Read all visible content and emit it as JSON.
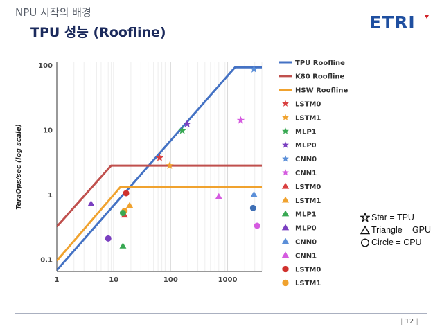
{
  "header": {
    "supertitle": "NPU 시작의 배경",
    "title": "TPU 성능 (Roofline)",
    "logo_text": "ETRI",
    "logo_color": "#1f4fa0",
    "logo_accent": "#d2232a"
  },
  "footer": {
    "page_number": "12"
  },
  "shape_key": [
    {
      "symbol": "star-outline",
      "label": "Star = TPU"
    },
    {
      "symbol": "triangle-outline",
      "label": "Triangle = GPU"
    },
    {
      "symbol": "circle-outline",
      "label": "Circle = CPU"
    }
  ],
  "chart_data": {
    "type": "scatter",
    "title": "",
    "xlabel": "",
    "ylabel": "TeraOps/sec (log scale)",
    "x_scale": "log",
    "y_scale": "log",
    "xlim": [
      1,
      4000
    ],
    "ylim": [
      0.065,
      110
    ],
    "x_ticks": [
      {
        "value": 1,
        "label": "1"
      },
      {
        "value": 10,
        "label": "10"
      },
      {
        "value": 100,
        "label": "100"
      },
      {
        "value": 1000,
        "label": "1000"
      }
    ],
    "y_ticks": [
      {
        "value": 0.1,
        "label": "0.1"
      },
      {
        "value": 1,
        "label": "1"
      },
      {
        "value": 10,
        "label": "10"
      },
      {
        "value": 100,
        "label": "100"
      }
    ],
    "grid": "vertical",
    "legend_position": "right",
    "rooflines": [
      {
        "name": "TPU Roofline",
        "color": "#4472c4",
        "points": [
          [
            1,
            0.068
          ],
          [
            1350,
            92
          ],
          [
            4000,
            92
          ]
        ]
      },
      {
        "name": "K80 Roofline",
        "color": "#c0504d",
        "points": [
          [
            1,
            0.32
          ],
          [
            9,
            2.8
          ],
          [
            4000,
            2.8
          ]
        ]
      },
      {
        "name": "HSW Roofline",
        "color": "#f0a22e",
        "points": [
          [
            1,
            0.095
          ],
          [
            13,
            1.3
          ],
          [
            4000,
            1.3
          ]
        ]
      }
    ],
    "series": [
      {
        "name": "LSTM0",
        "marker": "star",
        "color": "#d94040",
        "points": [
          [
            64,
            3.7
          ]
        ]
      },
      {
        "name": "LSTM1",
        "marker": "star",
        "color": "#f0a22e",
        "points": [
          [
            96,
            2.8
          ]
        ]
      },
      {
        "name": "MLP1",
        "marker": "star",
        "color": "#38a852",
        "points": [
          [
            160,
            9.7
          ]
        ]
      },
      {
        "name": "MLP0",
        "marker": "star",
        "color": "#7a3fc0",
        "points": [
          [
            195,
            12.3
          ]
        ]
      },
      {
        "name": "CNN0",
        "marker": "star",
        "color": "#5b8fd8",
        "points": [
          [
            2900,
            86
          ]
        ]
      },
      {
        "name": "CNN1",
        "marker": "star",
        "color": "#d55be0",
        "points": [
          [
            1700,
            14
          ]
        ]
      },
      {
        "name": "LSTM0",
        "marker": "triangle",
        "color": "#d94040",
        "points": [
          [
            15.5,
            0.48
          ]
        ]
      },
      {
        "name": "LSTM1",
        "marker": "triangle",
        "color": "#f0a22e",
        "points": [
          [
            19,
            0.68
          ]
        ]
      },
      {
        "name": "MLP1",
        "marker": "triangle",
        "color": "#38a852",
        "points": [
          [
            14.5,
            0.16
          ]
        ]
      },
      {
        "name": "MLP0",
        "marker": "triangle",
        "color": "#7a3fc0",
        "points": [
          [
            4,
            0.72
          ]
        ]
      },
      {
        "name": "CNN0",
        "marker": "triangle",
        "color": "#5b8fd8",
        "points": [
          [
            2900,
            1.0
          ]
        ]
      },
      {
        "name": "CNN1",
        "marker": "triangle",
        "color": "#d55be0",
        "points": [
          [
            700,
            0.93
          ]
        ]
      },
      {
        "name": "LSTM0",
        "marker": "circle",
        "color": "#d0312d",
        "points": [
          [
            16.5,
            1.05
          ]
        ]
      },
      {
        "name": "LSTM1",
        "marker": "circle",
        "color": "#f0a22e",
        "points": [
          [
            15.5,
            0.56
          ]
        ]
      },
      {
        "name": "CNN0",
        "marker": "circle",
        "color": "#3f6fb5",
        "points": [
          [
            2800,
            0.62
          ]
        ]
      },
      {
        "name": "CNN1",
        "marker": "circle",
        "color": "#d55be0",
        "points": [
          [
            3300,
            0.33
          ]
        ]
      },
      {
        "name": "MLP0",
        "marker": "circle",
        "color": "#7a3fc0",
        "points": [
          [
            8,
            0.21
          ]
        ]
      },
      {
        "name": "MLP1",
        "marker": "circle",
        "color": "#38a852",
        "points": [
          [
            14.5,
            0.52
          ]
        ]
      }
    ],
    "legend": [
      {
        "name": "TPU Roofline",
        "marker": "line",
        "color": "#4472c4"
      },
      {
        "name": "K80 Roofline",
        "marker": "line",
        "color": "#c0504d"
      },
      {
        "name": "HSW Roofline",
        "marker": "line",
        "color": "#f0a22e"
      },
      {
        "name": "LSTM0",
        "marker": "star",
        "color": "#d94040"
      },
      {
        "name": "LSTM1",
        "marker": "star",
        "color": "#f0a22e"
      },
      {
        "name": "MLP1",
        "marker": "star",
        "color": "#38a852"
      },
      {
        "name": "MLP0",
        "marker": "star",
        "color": "#7a3fc0"
      },
      {
        "name": "CNN0",
        "marker": "star",
        "color": "#5b8fd8"
      },
      {
        "name": "CNN1",
        "marker": "star",
        "color": "#d55be0"
      },
      {
        "name": "LSTM0",
        "marker": "triangle",
        "color": "#d94040"
      },
      {
        "name": "LSTM1",
        "marker": "triangle",
        "color": "#f0a22e"
      },
      {
        "name": "MLP1",
        "marker": "triangle",
        "color": "#38a852"
      },
      {
        "name": "MLP0",
        "marker": "triangle",
        "color": "#7a3fc0"
      },
      {
        "name": "CNN0",
        "marker": "triangle",
        "color": "#5b8fd8"
      },
      {
        "name": "CNN1",
        "marker": "triangle",
        "color": "#d55be0"
      },
      {
        "name": "LSTM0",
        "marker": "circle",
        "color": "#d0312d"
      },
      {
        "name": "LSTM1",
        "marker": "circle",
        "color": "#f0a22e"
      }
    ]
  }
}
